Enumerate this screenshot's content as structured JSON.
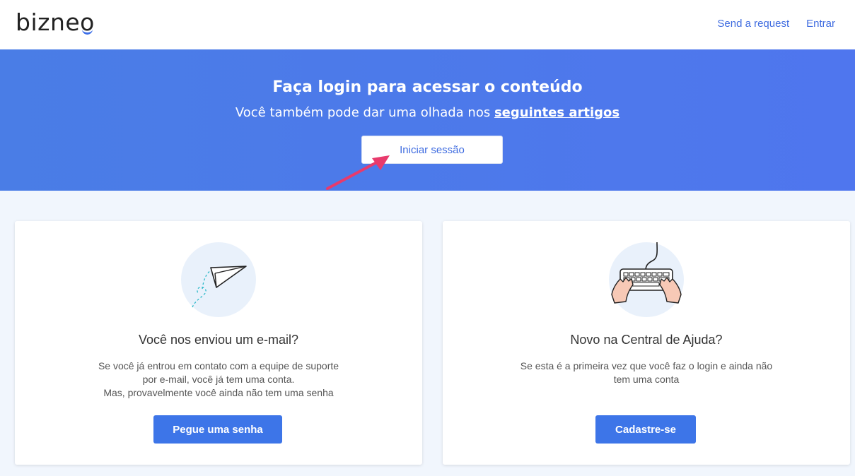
{
  "header": {
    "logo_text_start": "bizne",
    "logo_text_o": "o",
    "nav": {
      "send_request": "Send a request",
      "login": "Entrar"
    }
  },
  "hero": {
    "title": "Faça login para acessar o conteúdo",
    "subtitle_prefix": "Você também pode dar uma olhada nos ",
    "subtitle_link": "seguintes artigos",
    "login_button": "Iniciar sessão"
  },
  "cards": {
    "email": {
      "icon": "paper-plane-icon",
      "title": "Você nos enviou um e-mail?",
      "lines": [
        "Se você já entrou em contato com a equipe de suporte",
        "por e-mail, você já tem uma conta.",
        "Mas, provavelmente você ainda não tem uma senha"
      ],
      "button": "Pegue uma senha"
    },
    "new": {
      "icon": "keyboard-icon",
      "title": "Novo na Central de Ajuda?",
      "lines": [
        "Se esta é a primeira vez que você faz o login e ainda não",
        "tem uma conta"
      ],
      "button": "Cadastre-se"
    }
  },
  "colors": {
    "accent": "#3d75e8",
    "hero_bg": "#4a7de6",
    "arrow": "#e83a6c",
    "page_bg": "#f1f6fd"
  }
}
